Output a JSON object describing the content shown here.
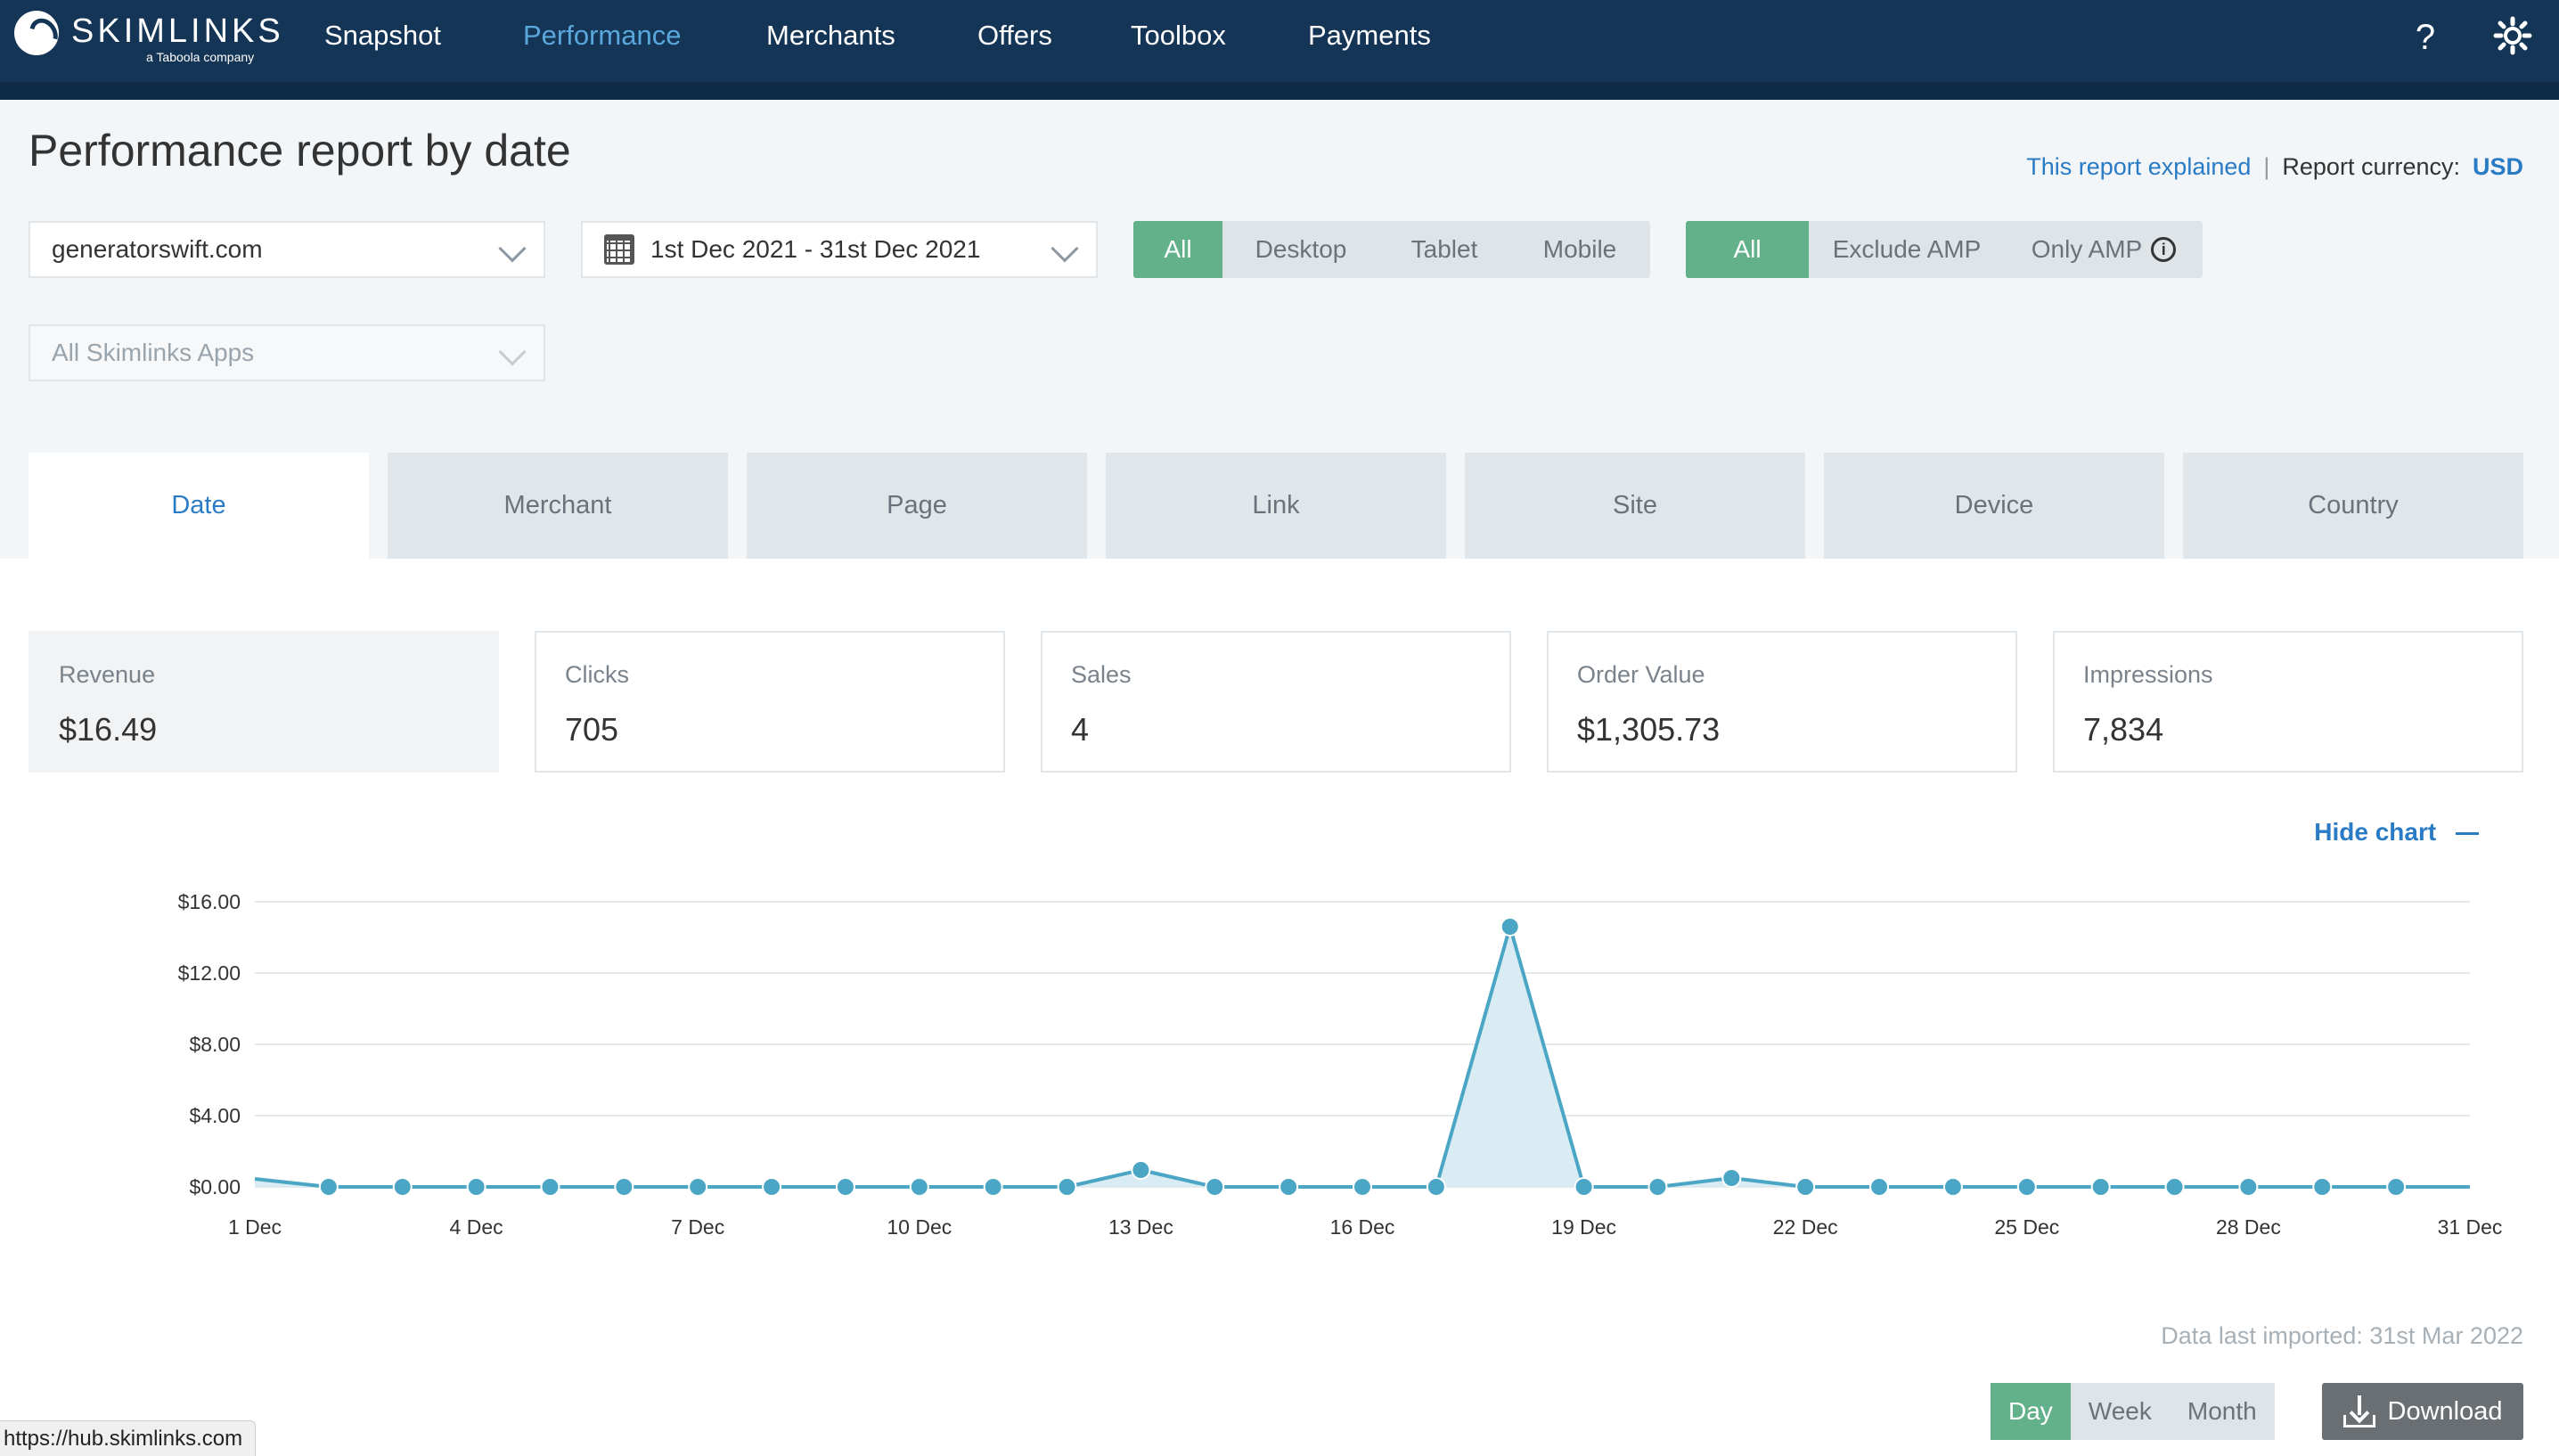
{
  "nav": {
    "logo_text": "SKIMLINKS",
    "logo_sub": "a Taboola company",
    "items": [
      "Snapshot",
      "Performance",
      "Merchants",
      "Offers",
      "Toolbox",
      "Payments"
    ],
    "active": "Performance",
    "help_icon": "question-icon",
    "settings_icon": "gear-icon"
  },
  "page": {
    "title": "Performance report by date",
    "report_explained": "This report explained",
    "currency_label": "Report currency:",
    "currency_value": "USD"
  },
  "filters": {
    "site": "generatorswift.com",
    "date_range": "1st Dec 2021 - 31st Dec 2021",
    "apps_placeholder": "All Skimlinks Apps",
    "device": [
      "All",
      "Desktop",
      "Tablet",
      "Mobile"
    ],
    "device_active": "All",
    "amp": [
      "All",
      "Exclude AMP",
      "Only AMP"
    ],
    "amp_active": "All"
  },
  "tabs": [
    "Date",
    "Merchant",
    "Page",
    "Link",
    "Site",
    "Device",
    "Country"
  ],
  "tab_active": "Date",
  "metrics": [
    {
      "label": "Revenue",
      "value": "$16.49"
    },
    {
      "label": "Clicks",
      "value": "705"
    },
    {
      "label": "Sales",
      "value": "4"
    },
    {
      "label": "Order Value",
      "value": "$1,305.73"
    },
    {
      "label": "Impressions",
      "value": "7,834"
    }
  ],
  "hide_chart": "Hide chart",
  "chart_data": {
    "type": "area",
    "x": [
      "1 Dec",
      "2 Dec",
      "3 Dec",
      "4 Dec",
      "5 Dec",
      "6 Dec",
      "7 Dec",
      "8 Dec",
      "9 Dec",
      "10 Dec",
      "11 Dec",
      "12 Dec",
      "13 Dec",
      "14 Dec",
      "15 Dec",
      "16 Dec",
      "17 Dec",
      "18 Dec",
      "19 Dec",
      "20 Dec",
      "21 Dec",
      "22 Dec",
      "23 Dec",
      "24 Dec",
      "25 Dec",
      "26 Dec",
      "27 Dec",
      "28 Dec",
      "29 Dec",
      "30 Dec",
      "31 Dec"
    ],
    "values": [
      0.45,
      0,
      0,
      0,
      0,
      0,
      0,
      0,
      0,
      0,
      0,
      0,
      0.95,
      0,
      0,
      0,
      0,
      14.6,
      0,
      0,
      0.5,
      0,
      0,
      0,
      0,
      0,
      0,
      0,
      0,
      0,
      0
    ],
    "x_tick_labels": [
      "1 Dec",
      "4 Dec",
      "7 Dec",
      "10 Dec",
      "13 Dec",
      "16 Dec",
      "19 Dec",
      "22 Dec",
      "25 Dec",
      "28 Dec",
      "31 Dec"
    ],
    "y_tick_labels": [
      "$0.00",
      "$4.00",
      "$8.00",
      "$12.00",
      "$16.00"
    ],
    "y_ticks": [
      0,
      4,
      8,
      12,
      16
    ],
    "ylim": [
      0,
      16
    ],
    "grid": true,
    "line_color": "#4aa6c4",
    "fill_color": "#d9ecf3"
  },
  "footer": {
    "last_imported": "Data last imported: 31st Mar 2022",
    "periods": [
      "Day",
      "Week",
      "Month"
    ],
    "period_active": "Day",
    "download": "Download",
    "status_url": "https://hub.skimlinks.com"
  },
  "colors": {
    "nav_bg": "#143556",
    "accent_green": "#63b18b",
    "link_blue": "#2a7bc5"
  }
}
